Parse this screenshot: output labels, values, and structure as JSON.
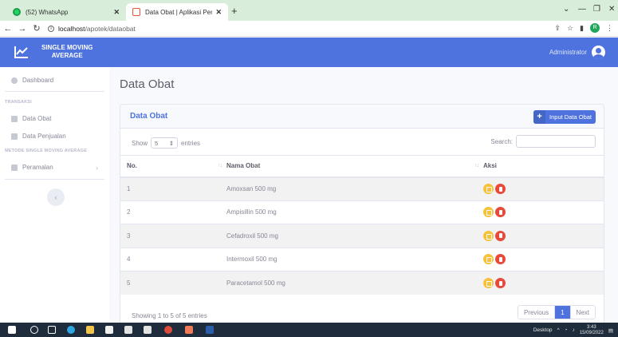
{
  "browser": {
    "tabs": [
      {
        "title": "(52) WhatsApp",
        "icon": "whatsapp-icon",
        "active": false
      },
      {
        "title": "Data Obat | Aplikasi Peramalan P",
        "icon": "app-favicon-icon",
        "active": true
      }
    ],
    "new_tab_symbol": "+",
    "url_host": "localhost",
    "url_path": "/apotek/dataobat",
    "profile_initial": "R"
  },
  "app": {
    "brand_line1": "SINGLE MOVING",
    "brand_line2": "AVERAGE",
    "user_name": "Administrator",
    "primary_color": "#4e73df"
  },
  "sidebar": {
    "dashboard": "Dashboard",
    "heading_transaksi": "TRANSAKSI",
    "data_obat": "Data Obat",
    "data_penjualan": "Data Penjualan",
    "heading_metode": "METODE SINGLE MOVING AVERAGE",
    "peramalan": "Peramalan",
    "toggle_symbol": "‹"
  },
  "main": {
    "page_title": "Data Obat",
    "card_title": "Data Obat",
    "add_button": "Input Data Obat",
    "show_label": "Show",
    "entries_value": "5",
    "entries_label": "entries",
    "search_label": "Search:",
    "columns": [
      "No.",
      "Nama Obat",
      "Aksi"
    ],
    "rows": [
      {
        "no": "1",
        "name": "Amoxsan 500 mg"
      },
      {
        "no": "2",
        "name": "Ampisillin 500 mg"
      },
      {
        "no": "3",
        "name": "Cefadroxil 500 mg"
      },
      {
        "no": "4",
        "name": "Intermoxil 500 mg"
      },
      {
        "no": "5",
        "name": "Paracetamol 500 mg"
      }
    ],
    "info": "Showing 1 to 5 of 5 entries",
    "pager": {
      "prev": "Previous",
      "current": "1",
      "next": "Next"
    }
  },
  "taskbar": {
    "desktop_label": "Desktop",
    "time": "3:43",
    "date": "15/09/2022"
  }
}
